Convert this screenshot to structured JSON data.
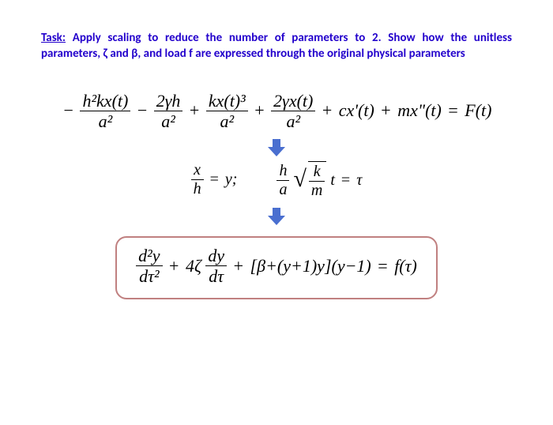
{
  "task": {
    "label": "Task:",
    "text": " Apply scaling to reduce the number of parameters to 2. Show how the unitless parameters, ζ and β, and load f are expressed through the original physical parameters"
  },
  "eq1": {
    "t1_num": "h²kx(t)",
    "t1_den": "a²",
    "t2_num": "2γh",
    "t2_den": "a²",
    "t3_num": "kx(t)³",
    "t3_den": "a²",
    "t4_num": "2γx(t)",
    "t4_den": "a²",
    "t5": "cx'(t)",
    "t6": "mx\"(t)",
    "rhs": "F(t)"
  },
  "subs": {
    "s1_lhs_num": "x",
    "s1_lhs_den": "h",
    "s1_rhs": "y;",
    "s2_lhs_num": "h",
    "s2_lhs_den": "a",
    "s2_rad_num": "k",
    "s2_rad_den": "m",
    "s2_mid": "t",
    "s2_rhs": "τ"
  },
  "result": {
    "t1_num": "d²y",
    "t1_den": "dτ²",
    "coef": "4ζ",
    "t2_num": "dy",
    "t2_den": "dτ",
    "bracket": "[β+(y+1)y](y−1)",
    "rhs": "f(τ)"
  },
  "arrow_color": "#4a6fd0"
}
